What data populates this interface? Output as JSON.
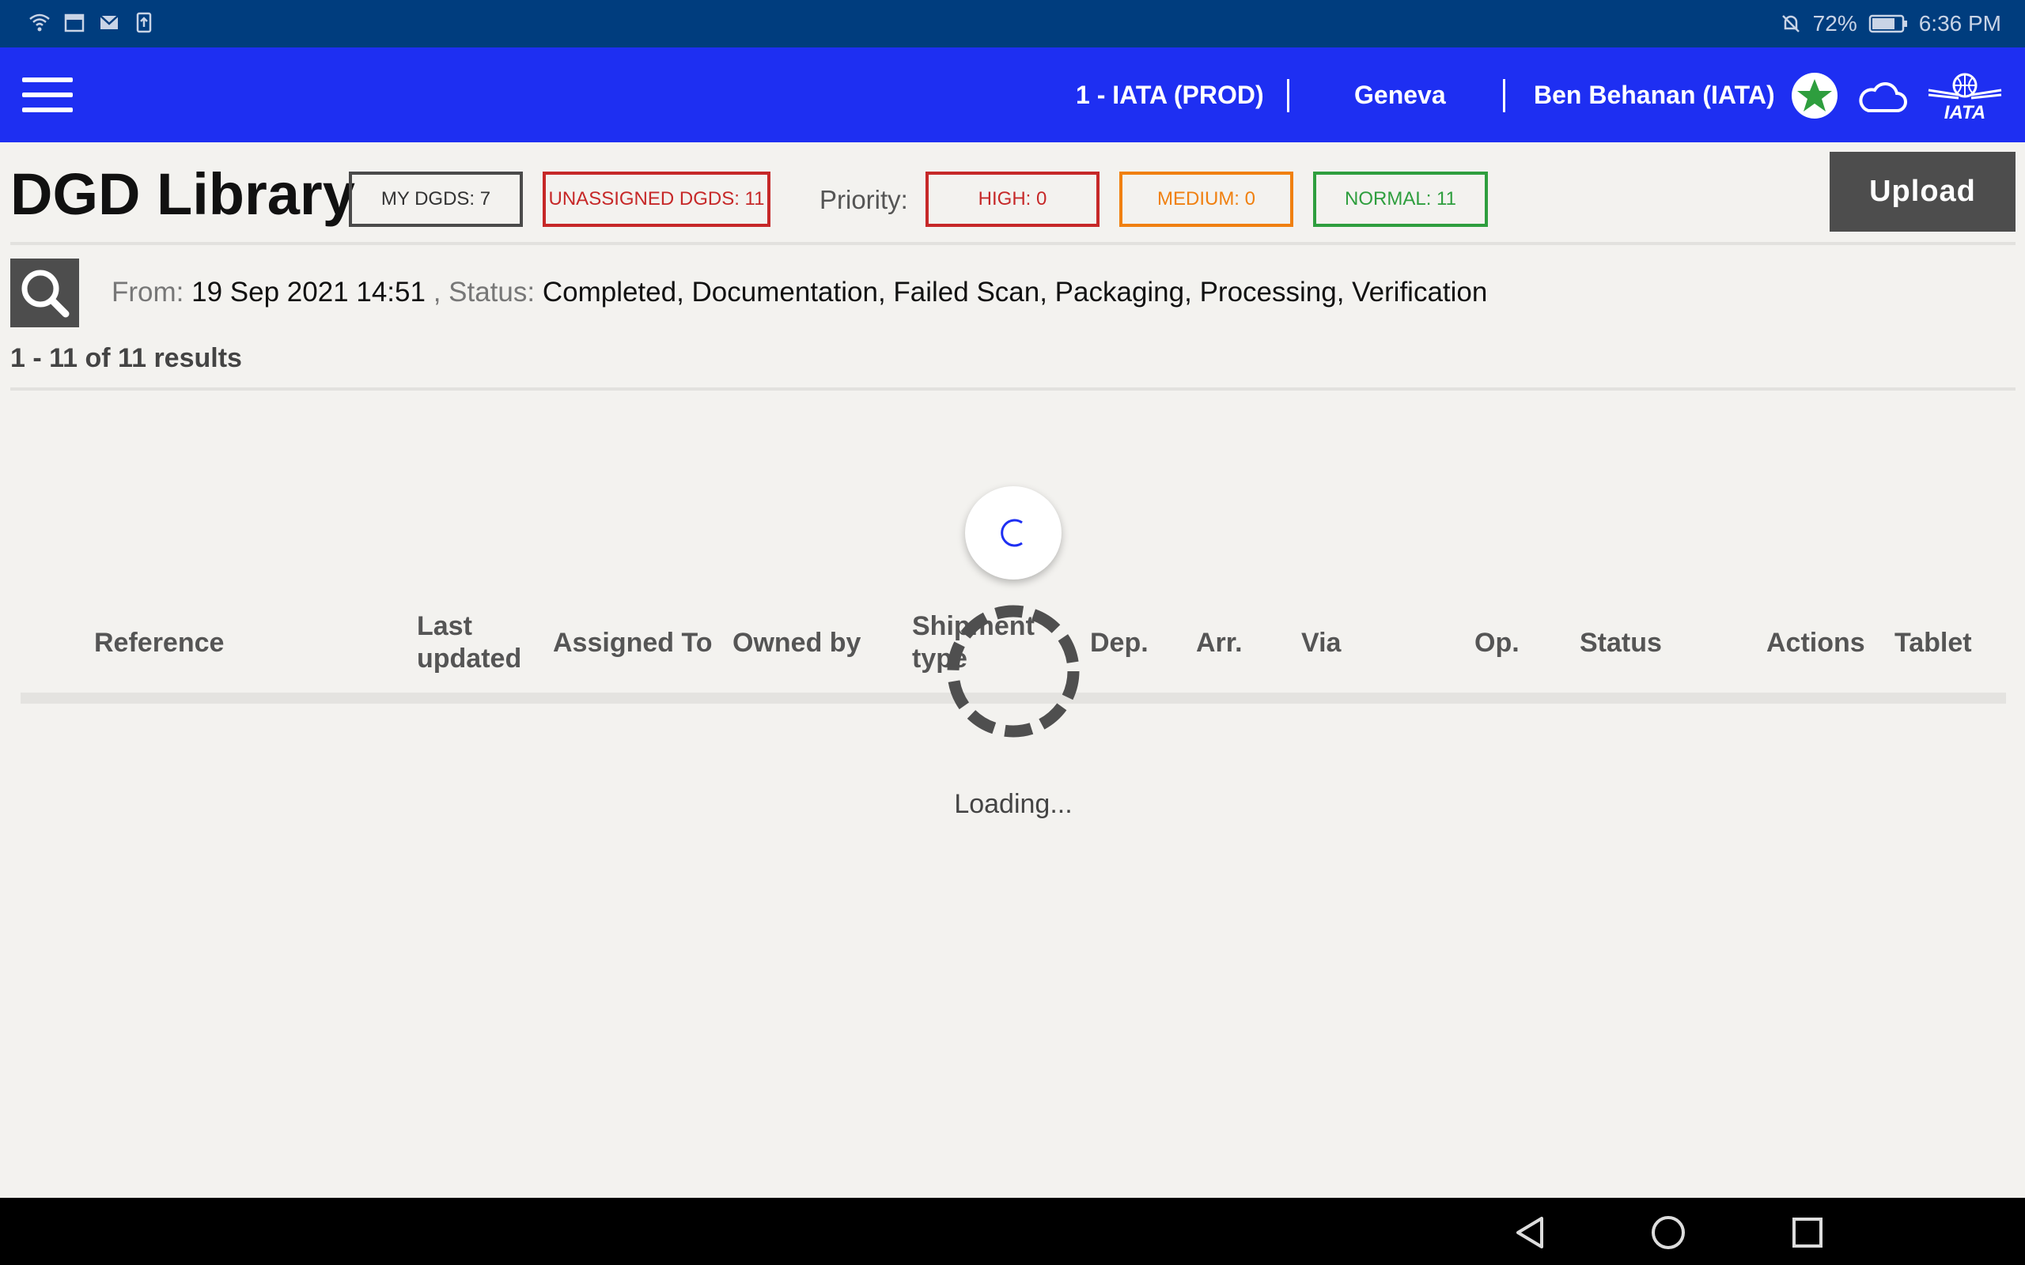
{
  "status_bar": {
    "battery": "72%",
    "time": "6:36 PM",
    "icons": [
      "wifi-icon",
      "calendar-icon",
      "mail-icon",
      "upload-icon",
      "notifications-off-icon",
      "battery-icon"
    ]
  },
  "header": {
    "org": "1 - IATA (PROD)",
    "location": "Geneva",
    "user": "Ben Behanan (IATA)",
    "icons": [
      "menu-icon",
      "star-icon",
      "cloud-icon",
      "iata-logo"
    ],
    "colors": {
      "bar": "#1e2ff2",
      "star": "#2e9e3e"
    }
  },
  "page": {
    "title": "DGD Library",
    "my_dgds": "MY DGDS: 7",
    "unassigned_dgds": "UNASSIGNED DGDS: 11",
    "priority_label": "Priority:",
    "high": "HIGH: 0",
    "medium": "MEDIUM: 0",
    "normal": "NORMAL: 11",
    "upload": "Upload",
    "colors": {
      "my": "#4a4a4a",
      "unassigned": "#c62828",
      "high": "#c62828",
      "medium": "#f08010",
      "normal": "#2e9e3e"
    }
  },
  "filter": {
    "from_label": "From:",
    "from_value": "19 Sep 2021 14:51",
    "status_label": ", Status:",
    "status_value": "Completed, Documentation, Failed Scan, Packaging, Processing, Verification"
  },
  "results": "1 - 11 of 11 results",
  "table": {
    "headers": {
      "reference": "Reference",
      "last_updated_1": "Last",
      "last_updated_2": "updated",
      "assigned_to": "Assigned To",
      "owned_by": "Owned by",
      "shipment_type_1": "Shipment",
      "shipment_type_2": "type",
      "dep": "Dep.",
      "arr": "Arr.",
      "via": "Via",
      "op": "Op.",
      "status": "Status",
      "actions": "Actions",
      "tablet": "Tablet"
    }
  },
  "loading": {
    "text": "Loading..."
  },
  "nav": {
    "icons": [
      "back-icon",
      "home-icon",
      "recents-icon"
    ]
  }
}
